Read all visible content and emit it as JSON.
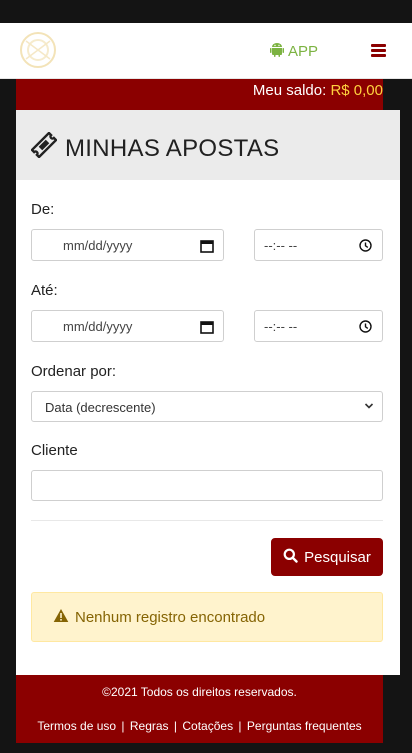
{
  "header": {
    "app_label": "APP",
    "icons": {
      "app": "android-icon",
      "menu": "hamburger-menu-icon",
      "logo": "brand-logo"
    },
    "colors": {
      "app_green": "#7cb342",
      "brand_red": "#8b0000"
    }
  },
  "balance": {
    "label": "Meu saldo:",
    "amount": "R$ 0,00",
    "amount_color": "#ffd23f"
  },
  "page": {
    "title": "MINHAS APOSTAS",
    "title_icon": "ticket-icon"
  },
  "filters": {
    "from_label": "De:",
    "to_label": "Até:",
    "date_placeholder": "mm/dd/yyyy",
    "time_placeholder": "--:-- --",
    "order_label": "Ordenar por:",
    "order_selected": "Data (decrescente)",
    "client_label": "Cliente",
    "client_value": ""
  },
  "search_button": {
    "label": "Pesquisar",
    "icon": "search-icon"
  },
  "alert": {
    "text": "Nenhum registro encontrado",
    "icon": "warning-icon"
  },
  "footer": {
    "copyright": "©2021 Todos os direitos reservados.",
    "links": [
      "Termos de uso",
      "Regras",
      "Cotações",
      "Perguntas frequentes"
    ],
    "separator": "|"
  }
}
